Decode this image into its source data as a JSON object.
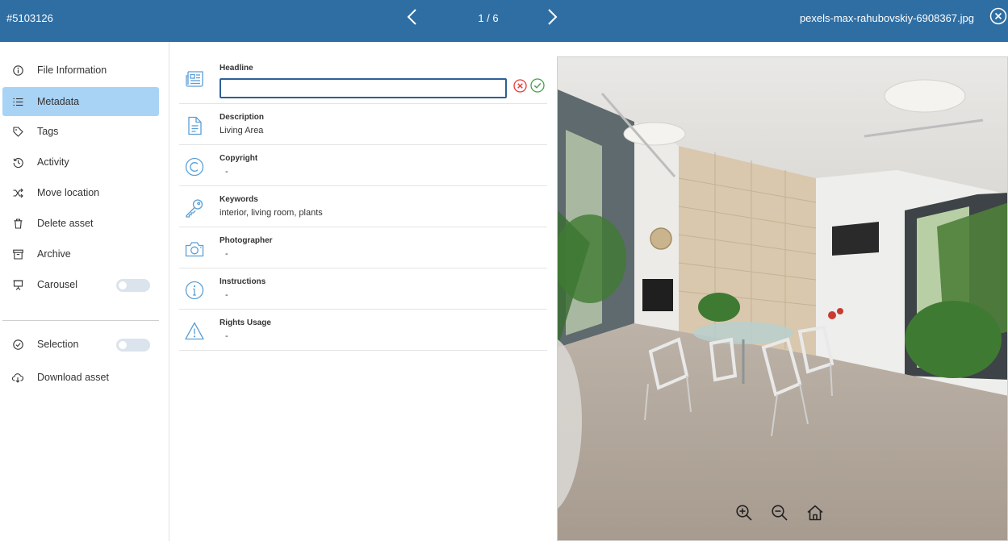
{
  "header": {
    "asset_id": "#5103126",
    "counter": "1 / 6",
    "filename": "pexels-max-rahubovskiy-6908367.jpg",
    "background_color": "#2f6ea3"
  },
  "sidebar": {
    "items": [
      {
        "label": "File Information",
        "icon": "info-icon"
      },
      {
        "label": "Metadata",
        "icon": "list-icon",
        "active": true
      },
      {
        "label": "Tags",
        "icon": "tag-icon"
      },
      {
        "label": "Activity",
        "icon": "history-icon"
      },
      {
        "label": "Move location",
        "icon": "shuffle-icon"
      },
      {
        "label": "Delete asset",
        "icon": "trash-icon"
      },
      {
        "label": "Archive",
        "icon": "archive-icon"
      },
      {
        "label": "Carousel",
        "icon": "presentation-icon",
        "toggle": false
      }
    ],
    "secondary": [
      {
        "label": "Selection",
        "icon": "check-circle-icon",
        "toggle": false
      },
      {
        "label": "Download asset",
        "icon": "cloud-download-icon"
      }
    ],
    "active_color": "#a9d3f5"
  },
  "metadata": {
    "headline": {
      "label": "Headline",
      "value": "",
      "icon": "newspaper-icon"
    },
    "rows": [
      {
        "label": "Description",
        "value": "Living Area",
        "icon": "document-icon"
      },
      {
        "label": "Copyright",
        "value": "-",
        "icon": "copyright-icon"
      },
      {
        "label": "Keywords",
        "value": "interior, living room, plants",
        "icon": "key-icon"
      },
      {
        "label": "Photographer",
        "value": "-",
        "icon": "camera-icon"
      },
      {
        "label": "Instructions",
        "value": "-",
        "icon": "info-circle-icon"
      },
      {
        "label": "Rights Usage",
        "value": "-",
        "icon": "warning-icon"
      }
    ],
    "icon_color": "#5b9fd6",
    "cancel_color": "#e53935",
    "confirm_color": "#43a047"
  },
  "preview": {
    "tools": [
      "zoom-in-icon",
      "zoom-out-icon",
      "home-icon"
    ]
  }
}
